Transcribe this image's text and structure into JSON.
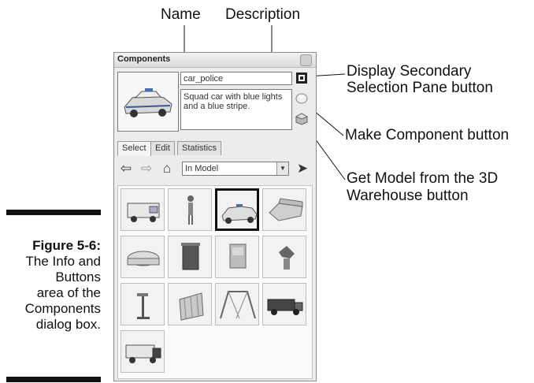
{
  "callouts": {
    "name": "Name",
    "description": "Description",
    "secondary_line1": "Display Secondary",
    "secondary_line2": "Selection Pane button",
    "make_component": "Make Component button",
    "get_model_line1": "Get Model from the 3D",
    "get_model_line2": "Warehouse button"
  },
  "caption": {
    "label": "Figure 5-6:",
    "lines": [
      "The Info and",
      "Buttons",
      "area of the",
      "Components",
      "dialog box."
    ]
  },
  "dialog": {
    "title": "Components",
    "name_value": "car_police",
    "description_value": "Squad car with blue lights and a blue stripe.",
    "tabs": [
      "Select",
      "Edit",
      "Statistics"
    ],
    "collection": "In Model",
    "components": [
      {
        "icon": "ambulance-icon"
      },
      {
        "icon": "person-icon"
      },
      {
        "icon": "police-car-icon",
        "selected": true
      },
      {
        "icon": "sofa-icon"
      },
      {
        "icon": "tub-icon"
      },
      {
        "icon": "trash-bin-icon"
      },
      {
        "icon": "cabinet-icon"
      },
      {
        "icon": "plant-icon"
      },
      {
        "icon": "street-lamp-icon"
      },
      {
        "icon": "radiator-icon"
      },
      {
        "icon": "swing-set-icon"
      },
      {
        "icon": "truck-icon"
      },
      {
        "icon": "fire-truck-icon"
      }
    ]
  }
}
